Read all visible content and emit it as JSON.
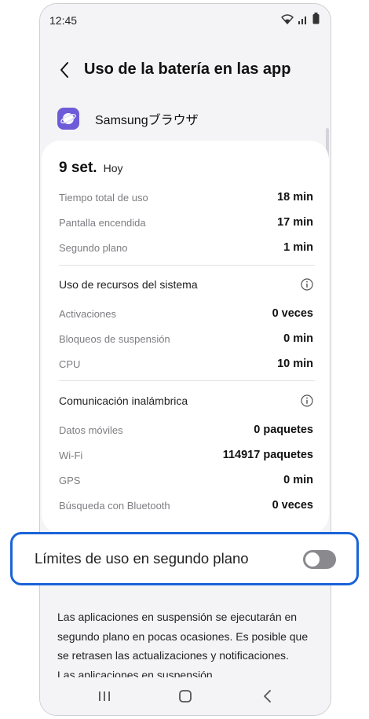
{
  "status": {
    "time": "12:45"
  },
  "header": {
    "title": "Uso de la batería en las app"
  },
  "app": {
    "name": "Samsungブラウザ"
  },
  "usage": {
    "date": "9 set.",
    "date_sub": "Hoy",
    "rows": [
      {
        "label": "Tiempo total de uso",
        "value": "18 min"
      },
      {
        "label": "Pantalla encendida",
        "value": "17 min"
      },
      {
        "label": "Segundo plano",
        "value": "1 min"
      }
    ]
  },
  "system": {
    "title": "Uso de recursos del sistema",
    "rows": [
      {
        "label": "Activaciones",
        "value": "0 veces"
      },
      {
        "label": "Bloqueos de suspensión",
        "value": "0 min"
      },
      {
        "label": "CPU",
        "value": "10 min"
      }
    ]
  },
  "wireless": {
    "title": "Comunicación inalámbrica",
    "rows": [
      {
        "label": "Datos móviles",
        "value": "0 paquetes"
      },
      {
        "label": "Wi-Fi",
        "value": "114917 paquetes"
      },
      {
        "label": "GPS",
        "value": "0 min"
      },
      {
        "label": "Búsqueda con Bluetooth",
        "value": "0 veces"
      }
    ]
  },
  "background_limit": {
    "label": "Límites de uso en segundo plano",
    "enabled": false
  },
  "description": "Las aplicaciones en suspensión se ejecutarán en segundo plano en pocas ocasiones. Es posible que se retrasen las actualizaciones y notificaciones. Las aplicaciones en suspensión",
  "colors": {
    "accent": "#1a63d8",
    "app_icon": "#6d5bd8",
    "toggle_off": "#8a8a8e"
  },
  "icons": [
    "back-icon",
    "samsung-internet-icon",
    "info-icon",
    "recents-icon",
    "home-icon",
    "nav-back-icon",
    "wifi-icon",
    "signal-icon",
    "battery-icon"
  ]
}
